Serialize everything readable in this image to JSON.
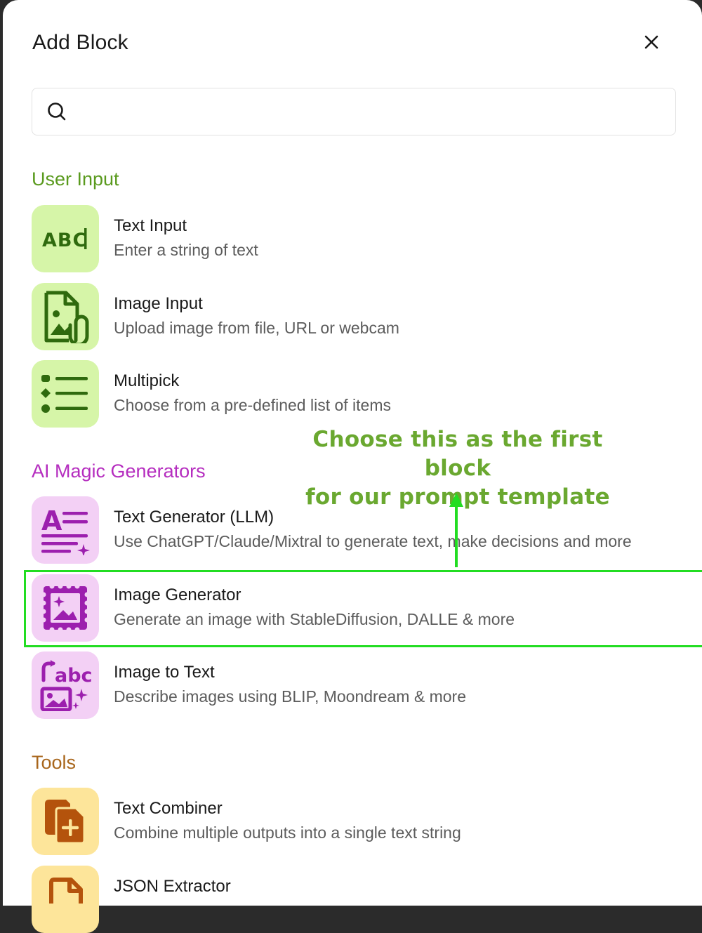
{
  "dialog": {
    "title": "Add Block",
    "close_icon": "close-icon",
    "search": {
      "value": "",
      "placeholder": "",
      "icon": "search-icon"
    }
  },
  "sections": {
    "user_input": {
      "title": "User Input",
      "color": "#5a9a1e",
      "items": [
        {
          "title": "Text Input",
          "description": "Enter a string of text",
          "icon": "abc-text-icon"
        },
        {
          "title": "Image Input",
          "description": "Upload image from file, URL or webcam",
          "icon": "image-attachment-icon"
        },
        {
          "title": "Multipick",
          "description": "Choose from a pre-defined list of items",
          "icon": "list-icon"
        }
      ]
    },
    "ai_magic": {
      "title": "AI Magic Generators",
      "color": "#b52dbf",
      "items": [
        {
          "title": "Text Generator (LLM)",
          "description": "Use ChatGPT/Claude/Mixtral to generate text, make decisions and more",
          "icon": "text-sparkle-icon"
        },
        {
          "title": "Image Generator",
          "description": "Generate an image with StableDiffusion, DALLE & more",
          "icon": "image-frame-sparkle-icon"
        },
        {
          "title": "Image to Text",
          "description": "Describe images using BLIP, Moondream & more",
          "icon": "image-to-text-icon"
        }
      ]
    },
    "tools": {
      "title": "Tools",
      "color": "#a8661c",
      "items": [
        {
          "title": "Text Combiner",
          "description": "Combine multiple outputs into a single text string",
          "icon": "copy-plus-icon"
        },
        {
          "title": "JSON Extractor",
          "description": "",
          "icon": "document-icon"
        }
      ]
    }
  },
  "annotation": {
    "text_line1": "Choose this as the first block",
    "text_line2": "for our prompt template",
    "color": "#6aa830",
    "highlight_color": "#22dd22"
  },
  "colors": {
    "green_tile": "#d6f5a8",
    "green_icon": "#2f6a0e",
    "purple_tile": "#f3d0f5",
    "purple_icon": "#9c1fae",
    "orange_tile": "#fde59a",
    "orange_icon": "#b4530c"
  }
}
